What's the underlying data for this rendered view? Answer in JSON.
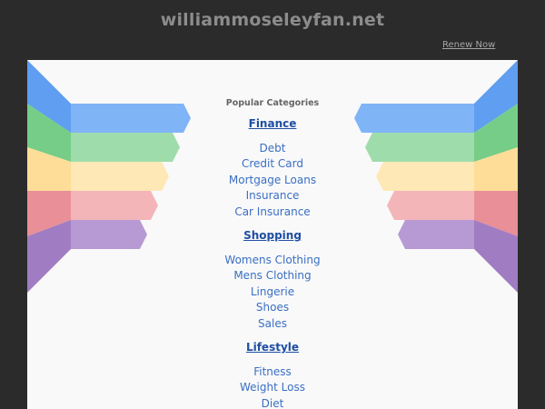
{
  "header": {
    "domain": "williammoseleyfan.net",
    "renew_label": "Renew Now"
  },
  "main": {
    "popular_label": "Popular Categories",
    "categories": [
      {
        "heading": "Finance",
        "links": [
          "Debt",
          "Credit Card",
          "Mortgage Loans",
          "Insurance",
          "Car Insurance"
        ]
      },
      {
        "heading": "Shopping",
        "links": [
          "Womens Clothing",
          "Mens Clothing",
          "Lingerie",
          "Shoes",
          "Sales"
        ]
      },
      {
        "heading": "Lifestyle",
        "links": [
          "Fitness",
          "Weight Loss",
          "Diet"
        ]
      }
    ]
  },
  "colors": {
    "background": "#2b2b2b",
    "panel": "#f9f9f9",
    "heading_link": "#1e4ea3",
    "link": "#3a6fc4",
    "ribbon_blue": "#6aa6f2",
    "ribbon_green": "#7fd08e",
    "ribbon_yellow": "#fde3a2",
    "ribbon_pink": "#eea0a6",
    "ribbon_purple": "#a98ac9"
  }
}
